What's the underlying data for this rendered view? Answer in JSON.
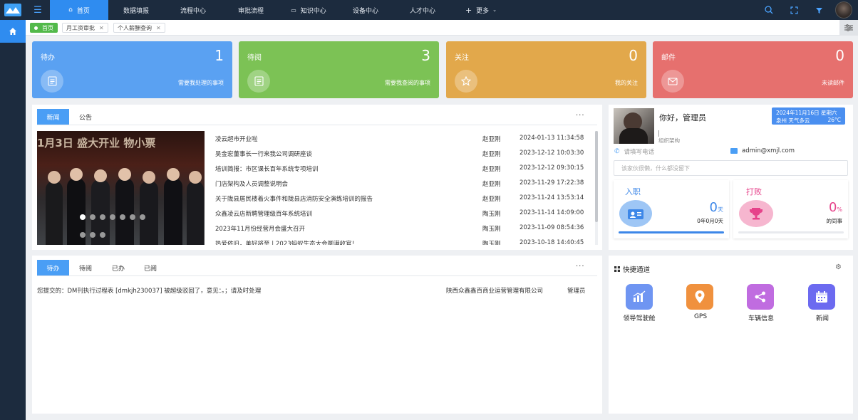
{
  "topnav": {
    "items": [
      {
        "label": "首页"
      },
      {
        "label": "数据填报"
      },
      {
        "label": "流程中心"
      },
      {
        "label": "审批流程"
      },
      {
        "label": "知识中心"
      },
      {
        "label": "设备中心"
      },
      {
        "label": "人才中心"
      },
      {
        "label": "更多"
      }
    ]
  },
  "page_tabs": [
    {
      "label": "首页"
    },
    {
      "label": "月工资审批"
    },
    {
      "label": "个人薪酬查询"
    }
  ],
  "stat_cards": [
    {
      "title": "待办",
      "count": "1",
      "desc": "需要我处理的事项",
      "color": "#5aa1f2"
    },
    {
      "title": "待阅",
      "count": "3",
      "desc": "需要我查阅的事项",
      "color": "#7cc255"
    },
    {
      "title": "关注",
      "count": "0",
      "desc": "我的关注",
      "color": "#e2a84b"
    },
    {
      "title": "邮件",
      "count": "0",
      "desc": "未读邮件",
      "color": "#e6706e"
    }
  ],
  "news_panel": {
    "tabs": [
      {
        "label": "新闻"
      },
      {
        "label": "公告"
      }
    ],
    "more": "···",
    "carousel_text": "1月3日 盛大开业 物小票",
    "items": [
      {
        "title": "凌云超市开业啦",
        "author": "赵亚刚",
        "time": "2024-01-13 11:34:58"
      },
      {
        "title": "吴金宏董事长一行来我公司调研座谈",
        "author": "赵亚刚",
        "time": "2023-12-12 10:03:30"
      },
      {
        "title": "培训简报：市区课长百年系统专项培训",
        "author": "赵亚刚",
        "time": "2023-12-12 09:30:15"
      },
      {
        "title": "门店架构及人员调整说明会",
        "author": "赵亚刚",
        "time": "2023-11-29 17:22:38"
      },
      {
        "title": "关于陇县居民楼着火事件和陇县店消防安全演练培训的报告",
        "author": "赵亚刚",
        "time": "2023-11-24 13:53:14"
      },
      {
        "title": "众鑫凌云店新聘管理级百年系统培训",
        "author": "陶玉刚",
        "time": "2023-11-14 14:09:00"
      },
      {
        "title": "2023年11月份经营月会盛大召开",
        "author": "陶玉刚",
        "time": "2023-11-09 08:54:36"
      },
      {
        "title": "热爱依旧，美好将至丨2023蚂蚁生态大会圆满收官！",
        "author": "陶玉刚",
        "time": "2023-10-18 14:40:45"
      }
    ]
  },
  "profile": {
    "greeting": "你好，管理员",
    "org": "组织架构",
    "phone_placeholder": "请填写电话",
    "email": "admin@xmjl.com",
    "signature_placeholder": "该家伙很懒，什么都没留下",
    "weather_date": "2024年11月16日 星期六",
    "weather_city": "泉州 天气多云",
    "weather_temp": "26°C"
  },
  "entry_card": {
    "title": "入职",
    "value": "0",
    "unit": "天",
    "sub": "0年0月0天"
  },
  "beat_card": {
    "title": "打败",
    "value": "0",
    "unit": "%",
    "sub": "的同事"
  },
  "todo_panel": {
    "tabs": [
      {
        "label": "待办"
      },
      {
        "label": "待阅"
      },
      {
        "label": "已办"
      },
      {
        "label": "已阅"
      }
    ],
    "more": "···",
    "items": [
      {
        "content": "您提交的：DM刊执行过程表 [dmkjh230037] 被超级驳回了，意见：。；请及时处理",
        "company": "陕西众鑫鑫百商业运营管理有限公司",
        "user": "管理员"
      }
    ]
  },
  "quick_panel": {
    "title": "快捷通道",
    "items": [
      {
        "label": "领导驾驶舱",
        "icon": "chart-icon",
        "color": "#6f95f2"
      },
      {
        "label": "GPS",
        "icon": "location-pin-icon",
        "color": "#f0913e"
      },
      {
        "label": "车辆信息",
        "icon": "share-icon",
        "color": "#c06ce0"
      },
      {
        "label": "新闻",
        "icon": "calendar-icon",
        "color": "#6c6af0"
      }
    ]
  }
}
